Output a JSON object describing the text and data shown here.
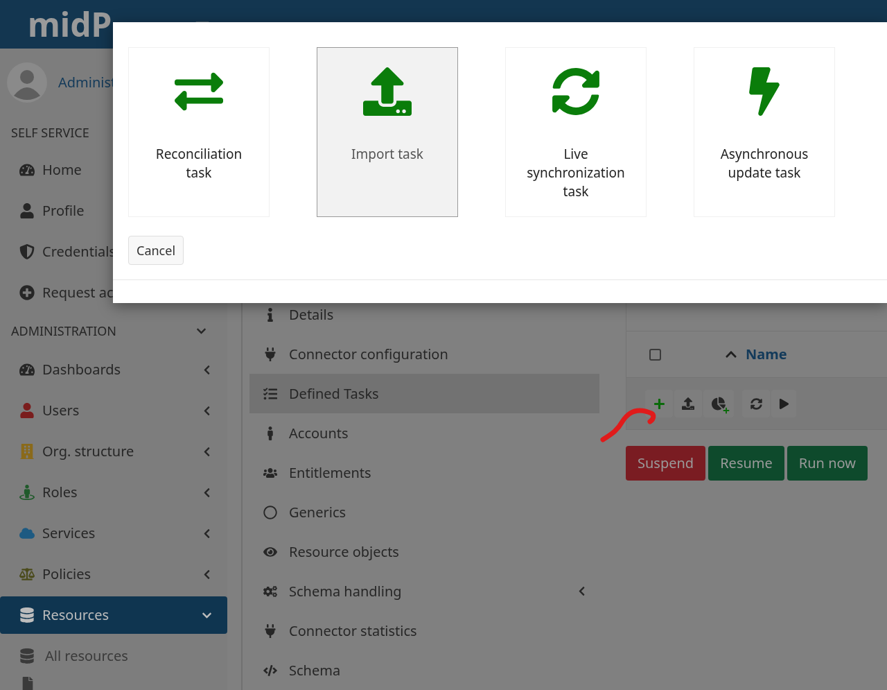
{
  "header": {
    "logo": "midP"
  },
  "sidebar": {
    "user": "Administ",
    "sections": [
      {
        "title": "SELF SERVICE",
        "items": [
          {
            "label": "Home",
            "selected": false
          },
          {
            "label": "Profile",
            "selected": false
          },
          {
            "label": "Credentials",
            "selected": false
          },
          {
            "label": "Request ac",
            "selected": false
          }
        ]
      },
      {
        "title": "ADMINISTRATION",
        "expanded": true,
        "items": [
          {
            "label": "Dashboards",
            "selected": false,
            "expanded": false
          },
          {
            "label": "Users",
            "selected": false,
            "expanded": false
          },
          {
            "label": "Org. structure",
            "selected": false,
            "expanded": false
          },
          {
            "label": "Roles",
            "selected": false,
            "expanded": false
          },
          {
            "label": "Services",
            "selected": false,
            "expanded": false
          },
          {
            "label": "Policies",
            "selected": false,
            "expanded": false
          },
          {
            "label": "Resources",
            "selected": true,
            "expanded": true,
            "children": [
              {
                "label": "All resources",
                "selected": false
              }
            ]
          }
        ]
      }
    ]
  },
  "resource_menu": [
    {
      "label": "Details",
      "selected": false
    },
    {
      "label": "Connector configuration",
      "selected": false
    },
    {
      "label": "Defined Tasks",
      "selected": true
    },
    {
      "label": "Accounts",
      "selected": false
    },
    {
      "label": "Entitlements",
      "selected": false
    },
    {
      "label": "Generics",
      "selected": false
    },
    {
      "label": "Resource objects",
      "selected": false
    },
    {
      "label": "Schema handling",
      "selected": false,
      "expanded": false
    },
    {
      "label": "Connector statistics",
      "selected": false
    },
    {
      "label": "Schema",
      "selected": false
    }
  ],
  "table": {
    "select_all_checked": false,
    "columns": [
      {
        "label": "Name",
        "sort_ascending": true
      }
    ]
  },
  "actions": [
    {
      "label": "Suspend",
      "kind": "danger"
    },
    {
      "label": "Resume",
      "kind": "success"
    },
    {
      "label": "Run now",
      "kind": "success"
    }
  ],
  "modal": {
    "options": [
      {
        "label": "Reconciliation task",
        "selected": false
      },
      {
        "label": "Import task",
        "selected": true
      },
      {
        "label": "Live synchronization task",
        "selected": false
      },
      {
        "label": "Asynchronous update task",
        "selected": false
      }
    ],
    "cancel": "Cancel"
  }
}
